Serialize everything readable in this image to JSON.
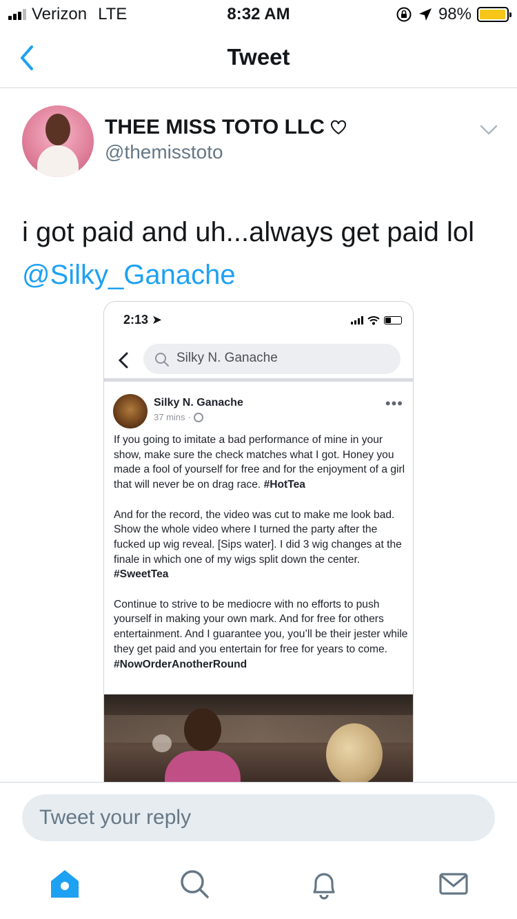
{
  "status_bar": {
    "carrier": "Verizon",
    "network": "LTE",
    "time": "8:32 AM",
    "battery_percent": "98%",
    "battery_level": 0.98,
    "battery_color": "#f5c518"
  },
  "nav": {
    "title": "Tweet",
    "back_icon": "chevron-left-icon"
  },
  "tweet": {
    "display_name": "THEE MISS TOTO LLC",
    "name_emoji": "♡",
    "handle": "@themisstoto",
    "text": "i got paid and uh...always get paid lol",
    "mention": "@Silky_Ganache",
    "mention_color": "#1da1f2"
  },
  "embedded_screenshot": {
    "time": "2:13",
    "search_query": "Silky N. Ganache",
    "post": {
      "author": "Silky N. Ganache",
      "timestamp": "37 mins",
      "meta_separator": "·",
      "more": "•••",
      "paragraph_1": "If you going to imitate a bad performance of mine in your show, make sure the check matches what I got. Honey you made a fool of yourself for free and for the enjoyment of a girl that will never be on drag race.",
      "hashtag_1": "#HotTea",
      "paragraph_2": "And for the record, the video was cut to make me look bad. Show the whole video where I turned the party after the fucked up wig reveal. [Sips water]. I did 3 wig changes at the finale in which one of my wigs split down the center.",
      "hashtag_2": "#SweetTea",
      "paragraph_3": "Continue to strive to be mediocre with no efforts to push yourself in making your own mark. And for free for others entertainment. And I guarantee you, you’ll be their jester while they get paid and you entertain for free for years to come.",
      "hashtag_3": "#NowOrderAnotherRound"
    }
  },
  "reply": {
    "placeholder": "Tweet your reply"
  },
  "tabbar": {
    "active_color": "#1da1f2",
    "inactive_color": "#657786",
    "icons": [
      "home-icon",
      "search-icon",
      "notifications-icon",
      "messages-icon"
    ]
  }
}
